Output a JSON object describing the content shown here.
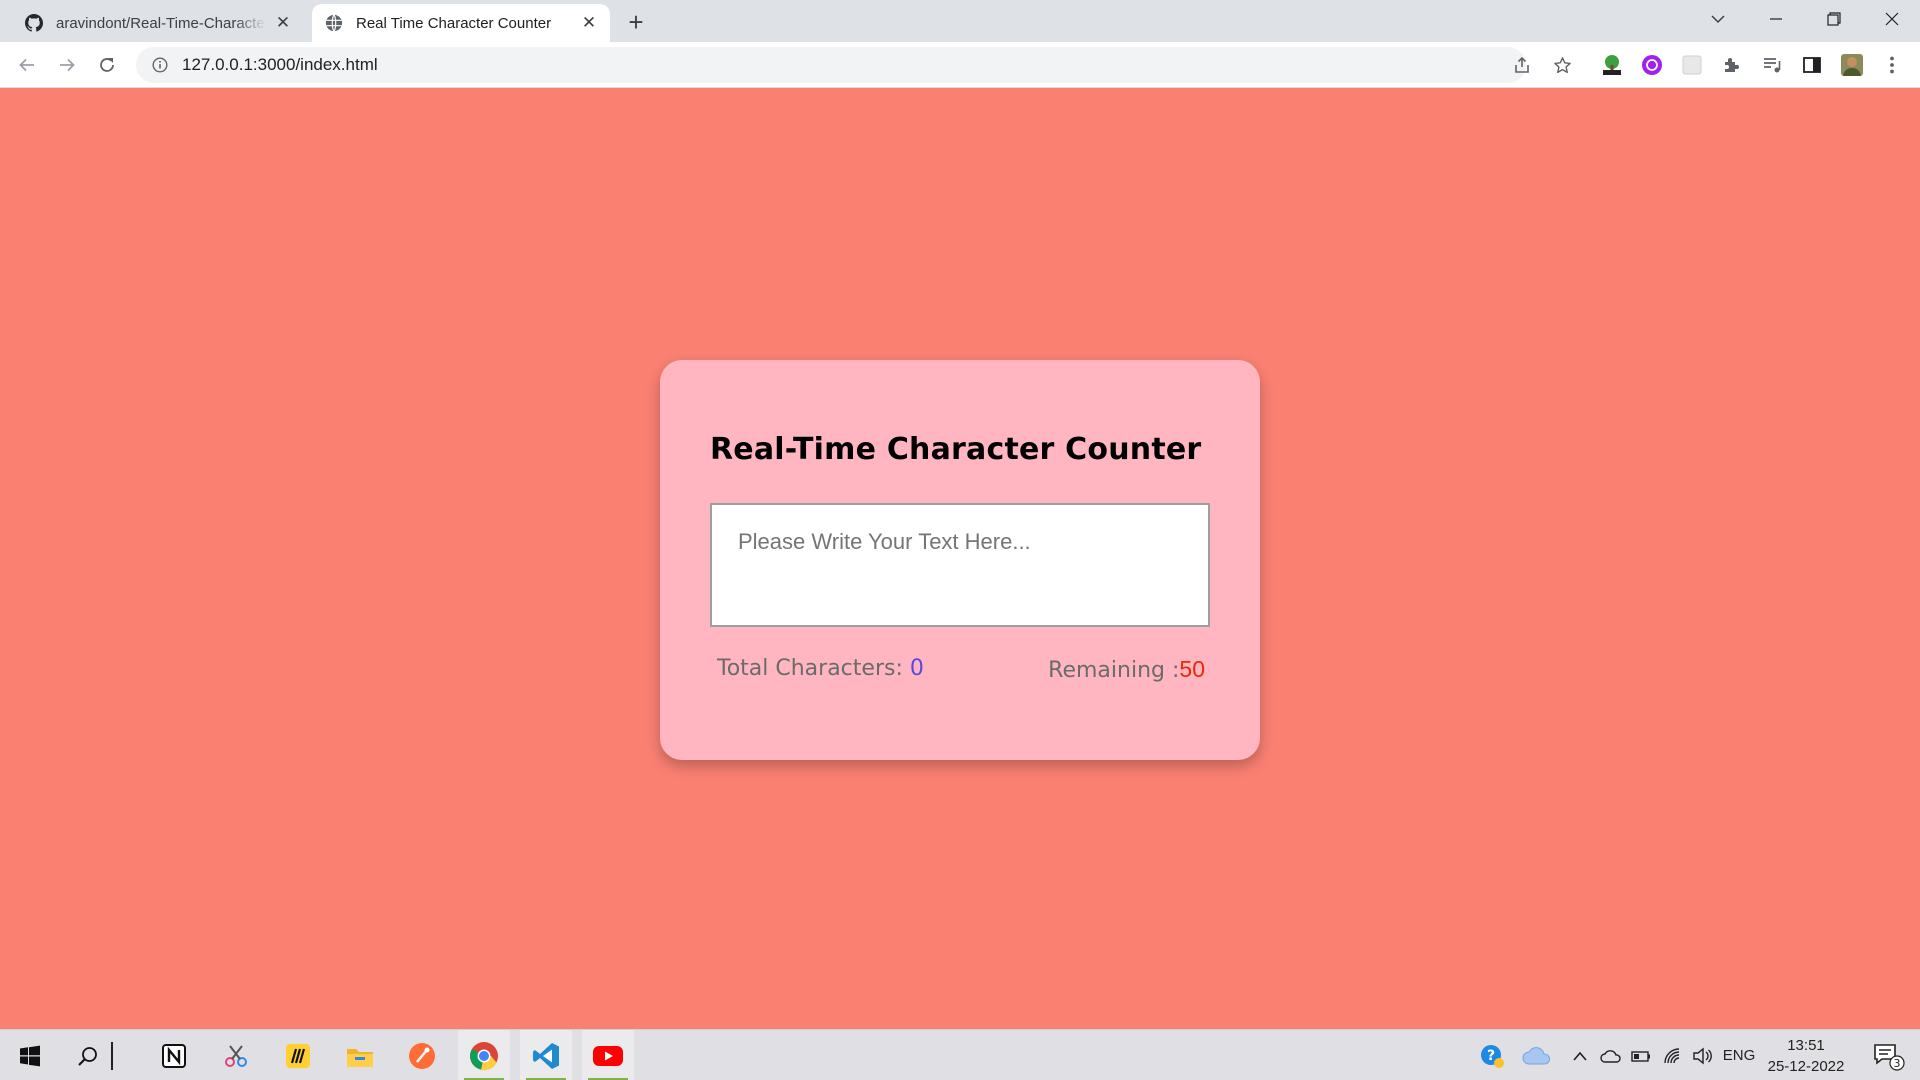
{
  "browser": {
    "tabs": [
      {
        "title": "aravindont/Real-Time-Character-Counter",
        "icon": "github-icon",
        "active": false
      },
      {
        "title": "Real Time Character Counter",
        "icon": "globe-icon",
        "active": true
      }
    ],
    "url": "127.0.0.1:3000/index.html"
  },
  "app": {
    "title": "Real-Time Character Counter",
    "textarea": {
      "value": "",
      "placeholder": "Please Write Your Text Here..."
    },
    "total_label": "Total Characters: ",
    "total_value": "0",
    "remaining_label": "Remaining :",
    "remaining_value": "50"
  },
  "colors": {
    "page_background": "#fa8072",
    "card_background": "#ffb6c1",
    "count_color": "#5a48e0",
    "remaining_color": "#e8290b"
  },
  "taskbar": {
    "apps": [
      "windows-start",
      "search",
      "notion",
      "snipping-tool",
      "miro",
      "file-explorer",
      "postman",
      "chrome",
      "vscode",
      "youtube"
    ],
    "language": "ENG",
    "time": "13:51",
    "date": "25-12-2022",
    "notification_count": "3"
  }
}
